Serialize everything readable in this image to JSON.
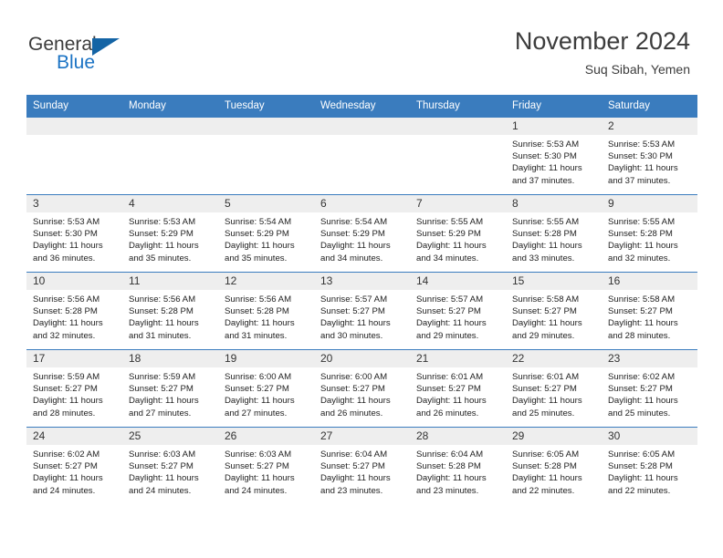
{
  "brand": {
    "name_part1": "General",
    "name_part2": "Blue",
    "triangle_color": "#1464a5",
    "blue_color": "#1b73c4"
  },
  "header": {
    "title": "November 2024",
    "subtitle": "Suq Sibah, Yemen"
  },
  "theme": {
    "header_row_bg": "#3a7cbe",
    "header_row_text": "#ffffff",
    "daynum_bg": "#eeeeee",
    "grid_line": "#3a7cbe",
    "body_text": "#222222"
  },
  "weekday_headers": [
    "Sunday",
    "Monday",
    "Tuesday",
    "Wednesday",
    "Thursday",
    "Friday",
    "Saturday"
  ],
  "weeks": [
    [
      {
        "day": "",
        "empty": true
      },
      {
        "day": "",
        "empty": true
      },
      {
        "day": "",
        "empty": true
      },
      {
        "day": "",
        "empty": true
      },
      {
        "day": "",
        "empty": true
      },
      {
        "day": "1",
        "sunrise": "Sunrise: 5:53 AM",
        "sunset": "Sunset: 5:30 PM",
        "daylight_line1": "Daylight: 11 hours",
        "daylight_line2": "and 37 minutes."
      },
      {
        "day": "2",
        "sunrise": "Sunrise: 5:53 AM",
        "sunset": "Sunset: 5:30 PM",
        "daylight_line1": "Daylight: 11 hours",
        "daylight_line2": "and 37 minutes."
      }
    ],
    [
      {
        "day": "3",
        "sunrise": "Sunrise: 5:53 AM",
        "sunset": "Sunset: 5:30 PM",
        "daylight_line1": "Daylight: 11 hours",
        "daylight_line2": "and 36 minutes."
      },
      {
        "day": "4",
        "sunrise": "Sunrise: 5:53 AM",
        "sunset": "Sunset: 5:29 PM",
        "daylight_line1": "Daylight: 11 hours",
        "daylight_line2": "and 35 minutes."
      },
      {
        "day": "5",
        "sunrise": "Sunrise: 5:54 AM",
        "sunset": "Sunset: 5:29 PM",
        "daylight_line1": "Daylight: 11 hours",
        "daylight_line2": "and 35 minutes."
      },
      {
        "day": "6",
        "sunrise": "Sunrise: 5:54 AM",
        "sunset": "Sunset: 5:29 PM",
        "daylight_line1": "Daylight: 11 hours",
        "daylight_line2": "and 34 minutes."
      },
      {
        "day": "7",
        "sunrise": "Sunrise: 5:55 AM",
        "sunset": "Sunset: 5:29 PM",
        "daylight_line1": "Daylight: 11 hours",
        "daylight_line2": "and 34 minutes."
      },
      {
        "day": "8",
        "sunrise": "Sunrise: 5:55 AM",
        "sunset": "Sunset: 5:28 PM",
        "daylight_line1": "Daylight: 11 hours",
        "daylight_line2": "and 33 minutes."
      },
      {
        "day": "9",
        "sunrise": "Sunrise: 5:55 AM",
        "sunset": "Sunset: 5:28 PM",
        "daylight_line1": "Daylight: 11 hours",
        "daylight_line2": "and 32 minutes."
      }
    ],
    [
      {
        "day": "10",
        "sunrise": "Sunrise: 5:56 AM",
        "sunset": "Sunset: 5:28 PM",
        "daylight_line1": "Daylight: 11 hours",
        "daylight_line2": "and 32 minutes."
      },
      {
        "day": "11",
        "sunrise": "Sunrise: 5:56 AM",
        "sunset": "Sunset: 5:28 PM",
        "daylight_line1": "Daylight: 11 hours",
        "daylight_line2": "and 31 minutes."
      },
      {
        "day": "12",
        "sunrise": "Sunrise: 5:56 AM",
        "sunset": "Sunset: 5:28 PM",
        "daylight_line1": "Daylight: 11 hours",
        "daylight_line2": "and 31 minutes."
      },
      {
        "day": "13",
        "sunrise": "Sunrise: 5:57 AM",
        "sunset": "Sunset: 5:27 PM",
        "daylight_line1": "Daylight: 11 hours",
        "daylight_line2": "and 30 minutes."
      },
      {
        "day": "14",
        "sunrise": "Sunrise: 5:57 AM",
        "sunset": "Sunset: 5:27 PM",
        "daylight_line1": "Daylight: 11 hours",
        "daylight_line2": "and 29 minutes."
      },
      {
        "day": "15",
        "sunrise": "Sunrise: 5:58 AM",
        "sunset": "Sunset: 5:27 PM",
        "daylight_line1": "Daylight: 11 hours",
        "daylight_line2": "and 29 minutes."
      },
      {
        "day": "16",
        "sunrise": "Sunrise: 5:58 AM",
        "sunset": "Sunset: 5:27 PM",
        "daylight_line1": "Daylight: 11 hours",
        "daylight_line2": "and 28 minutes."
      }
    ],
    [
      {
        "day": "17",
        "sunrise": "Sunrise: 5:59 AM",
        "sunset": "Sunset: 5:27 PM",
        "daylight_line1": "Daylight: 11 hours",
        "daylight_line2": "and 28 minutes."
      },
      {
        "day": "18",
        "sunrise": "Sunrise: 5:59 AM",
        "sunset": "Sunset: 5:27 PM",
        "daylight_line1": "Daylight: 11 hours",
        "daylight_line2": "and 27 minutes."
      },
      {
        "day": "19",
        "sunrise": "Sunrise: 6:00 AM",
        "sunset": "Sunset: 5:27 PM",
        "daylight_line1": "Daylight: 11 hours",
        "daylight_line2": "and 27 minutes."
      },
      {
        "day": "20",
        "sunrise": "Sunrise: 6:00 AM",
        "sunset": "Sunset: 5:27 PM",
        "daylight_line1": "Daylight: 11 hours",
        "daylight_line2": "and 26 minutes."
      },
      {
        "day": "21",
        "sunrise": "Sunrise: 6:01 AM",
        "sunset": "Sunset: 5:27 PM",
        "daylight_line1": "Daylight: 11 hours",
        "daylight_line2": "and 26 minutes."
      },
      {
        "day": "22",
        "sunrise": "Sunrise: 6:01 AM",
        "sunset": "Sunset: 5:27 PM",
        "daylight_line1": "Daylight: 11 hours",
        "daylight_line2": "and 25 minutes."
      },
      {
        "day": "23",
        "sunrise": "Sunrise: 6:02 AM",
        "sunset": "Sunset: 5:27 PM",
        "daylight_line1": "Daylight: 11 hours",
        "daylight_line2": "and 25 minutes."
      }
    ],
    [
      {
        "day": "24",
        "sunrise": "Sunrise: 6:02 AM",
        "sunset": "Sunset: 5:27 PM",
        "daylight_line1": "Daylight: 11 hours",
        "daylight_line2": "and 24 minutes."
      },
      {
        "day": "25",
        "sunrise": "Sunrise: 6:03 AM",
        "sunset": "Sunset: 5:27 PM",
        "daylight_line1": "Daylight: 11 hours",
        "daylight_line2": "and 24 minutes."
      },
      {
        "day": "26",
        "sunrise": "Sunrise: 6:03 AM",
        "sunset": "Sunset: 5:27 PM",
        "daylight_line1": "Daylight: 11 hours",
        "daylight_line2": "and 24 minutes."
      },
      {
        "day": "27",
        "sunrise": "Sunrise: 6:04 AM",
        "sunset": "Sunset: 5:27 PM",
        "daylight_line1": "Daylight: 11 hours",
        "daylight_line2": "and 23 minutes."
      },
      {
        "day": "28",
        "sunrise": "Sunrise: 6:04 AM",
        "sunset": "Sunset: 5:28 PM",
        "daylight_line1": "Daylight: 11 hours",
        "daylight_line2": "and 23 minutes."
      },
      {
        "day": "29",
        "sunrise": "Sunrise: 6:05 AM",
        "sunset": "Sunset: 5:28 PM",
        "daylight_line1": "Daylight: 11 hours",
        "daylight_line2": "and 22 minutes."
      },
      {
        "day": "30",
        "sunrise": "Sunrise: 6:05 AM",
        "sunset": "Sunset: 5:28 PM",
        "daylight_line1": "Daylight: 11 hours",
        "daylight_line2": "and 22 minutes."
      }
    ]
  ]
}
